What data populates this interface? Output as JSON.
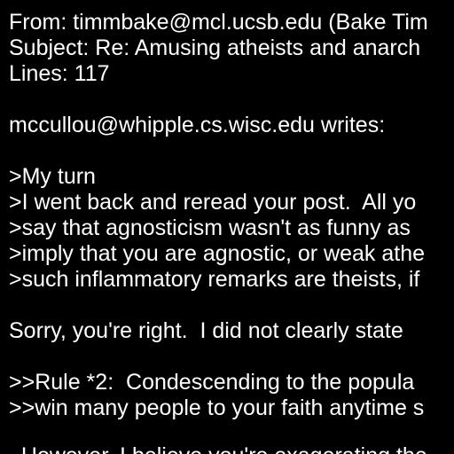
{
  "header": {
    "from": "From: timmbake@mcl.ucsb.edu (Bake Tim",
    "subject": "Subject: Re: Amusing atheists and anarch",
    "lines": "Lines: 117"
  },
  "body": {
    "attribution": "mccullou@whipple.cs.wisc.edu writes:",
    "quote_1": ">My turn",
    "quote_2": ">I went back and reread your post.  All yo",
    "quote_3": ">say that agnosticism wasn't as funny as",
    "quote_4": ">imply that you are agnostic, or weak athe",
    "quote_5": ">such inflammatory remarks are theists, if",
    "reply_1": "Sorry, you're right.  I did not clearly state",
    "quote_6": ">>Rule *2:  Condescending to the popula",
    "quote_7": ">>win many people to your faith anytime s",
    "partial": "  However, I believe you're exagerating the"
  },
  "colors": {
    "background": "#000000",
    "text": "#ffffff"
  }
}
